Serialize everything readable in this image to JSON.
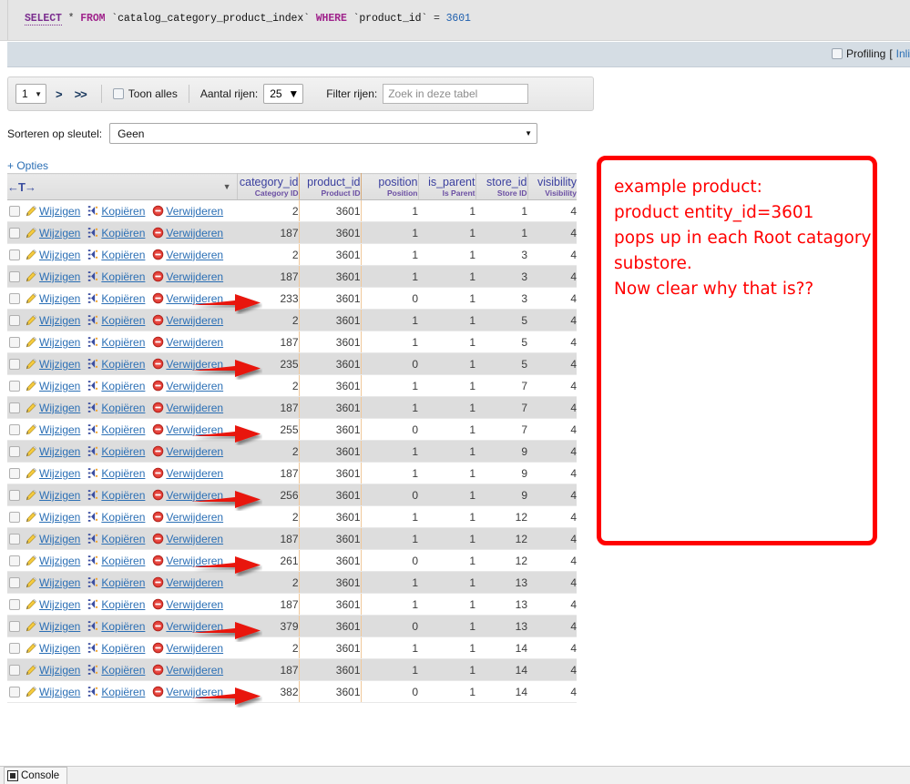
{
  "sql": {
    "keyword_select": "SELECT",
    "star": "*",
    "keyword_from": "FROM",
    "table": "`catalog_category_product_index`",
    "keyword_where": "WHERE",
    "column": "`product_id`",
    "operator": "=",
    "value": "3601",
    "full_text": "SELECT * FROM `catalog_category_product_index` WHERE `product_id` = 3601"
  },
  "profiling": {
    "label": "Profiling",
    "bracket_open": "[",
    "link_text": "Inli"
  },
  "toolbar": {
    "page_number": "1",
    "next_page_arrow": ">",
    "last_page_arrow": ">>",
    "show_all_label": "Toon alles",
    "rows_count_label": "Aantal rijen:",
    "rows_count_value": "25",
    "filter_label": "Filter rijen:",
    "filter_placeholder": "Zoek in deze tabel",
    "filter_value": ""
  },
  "sort_by_key": {
    "label": "Sorteren op sleutel:",
    "value": "Geen"
  },
  "options_link": "+ Opties",
  "table": {
    "move_columns_icon": "←T→",
    "actions": {
      "edit": "Wijzigen",
      "copy": "Kopiëren",
      "delete": "Verwijderen"
    },
    "columns": [
      {
        "name": "category_id",
        "sub": "Category ID"
      },
      {
        "name": "product_id",
        "sub": "Product ID"
      },
      {
        "name": "position",
        "sub": "Position"
      },
      {
        "name": "is_parent",
        "sub": "Is Parent"
      },
      {
        "name": "store_id",
        "sub": "Store ID"
      },
      {
        "name": "visibility",
        "sub": "Visibility"
      }
    ],
    "rows": [
      {
        "category_id": "2",
        "product_id": "3601",
        "position": "1",
        "is_parent": "1",
        "store_id": "1",
        "visibility": "4",
        "arrow": false
      },
      {
        "category_id": "187",
        "product_id": "3601",
        "position": "1",
        "is_parent": "1",
        "store_id": "1",
        "visibility": "4",
        "arrow": false
      },
      {
        "category_id": "2",
        "product_id": "3601",
        "position": "1",
        "is_parent": "1",
        "store_id": "3",
        "visibility": "4",
        "arrow": false
      },
      {
        "category_id": "187",
        "product_id": "3601",
        "position": "1",
        "is_parent": "1",
        "store_id": "3",
        "visibility": "4",
        "arrow": false
      },
      {
        "category_id": "233",
        "product_id": "3601",
        "position": "0",
        "is_parent": "1",
        "store_id": "3",
        "visibility": "4",
        "arrow": true
      },
      {
        "category_id": "2",
        "product_id": "3601",
        "position": "1",
        "is_parent": "1",
        "store_id": "5",
        "visibility": "4",
        "arrow": false
      },
      {
        "category_id": "187",
        "product_id": "3601",
        "position": "1",
        "is_parent": "1",
        "store_id": "5",
        "visibility": "4",
        "arrow": false
      },
      {
        "category_id": "235",
        "product_id": "3601",
        "position": "0",
        "is_parent": "1",
        "store_id": "5",
        "visibility": "4",
        "arrow": true
      },
      {
        "category_id": "2",
        "product_id": "3601",
        "position": "1",
        "is_parent": "1",
        "store_id": "7",
        "visibility": "4",
        "arrow": false
      },
      {
        "category_id": "187",
        "product_id": "3601",
        "position": "1",
        "is_parent": "1",
        "store_id": "7",
        "visibility": "4",
        "arrow": false
      },
      {
        "category_id": "255",
        "product_id": "3601",
        "position": "0",
        "is_parent": "1",
        "store_id": "7",
        "visibility": "4",
        "arrow": true
      },
      {
        "category_id": "2",
        "product_id": "3601",
        "position": "1",
        "is_parent": "1",
        "store_id": "9",
        "visibility": "4",
        "arrow": false
      },
      {
        "category_id": "187",
        "product_id": "3601",
        "position": "1",
        "is_parent": "1",
        "store_id": "9",
        "visibility": "4",
        "arrow": false
      },
      {
        "category_id": "256",
        "product_id": "3601",
        "position": "0",
        "is_parent": "1",
        "store_id": "9",
        "visibility": "4",
        "arrow": true
      },
      {
        "category_id": "2",
        "product_id": "3601",
        "position": "1",
        "is_parent": "1",
        "store_id": "12",
        "visibility": "4",
        "arrow": false
      },
      {
        "category_id": "187",
        "product_id": "3601",
        "position": "1",
        "is_parent": "1",
        "store_id": "12",
        "visibility": "4",
        "arrow": false
      },
      {
        "category_id": "261",
        "product_id": "3601",
        "position": "0",
        "is_parent": "1",
        "store_id": "12",
        "visibility": "4",
        "arrow": true
      },
      {
        "category_id": "2",
        "product_id": "3601",
        "position": "1",
        "is_parent": "1",
        "store_id": "13",
        "visibility": "4",
        "arrow": false
      },
      {
        "category_id": "187",
        "product_id": "3601",
        "position": "1",
        "is_parent": "1",
        "store_id": "13",
        "visibility": "4",
        "arrow": false
      },
      {
        "category_id": "379",
        "product_id": "3601",
        "position": "0",
        "is_parent": "1",
        "store_id": "13",
        "visibility": "4",
        "arrow": true
      },
      {
        "category_id": "2",
        "product_id": "3601",
        "position": "1",
        "is_parent": "1",
        "store_id": "14",
        "visibility": "4",
        "arrow": false
      },
      {
        "category_id": "187",
        "product_id": "3601",
        "position": "1",
        "is_parent": "1",
        "store_id": "14",
        "visibility": "4",
        "arrow": false
      },
      {
        "category_id": "382",
        "product_id": "3601",
        "position": "0",
        "is_parent": "1",
        "store_id": "14",
        "visibility": "4",
        "arrow": true
      }
    ]
  },
  "annotation": {
    "color": "#ff0000",
    "lines": [
      "example product:",
      "product entity_id=3601",
      "pops up in each Root catagory",
      "substore.",
      "Now clear why that is??"
    ]
  },
  "console": {
    "label": "Console"
  }
}
